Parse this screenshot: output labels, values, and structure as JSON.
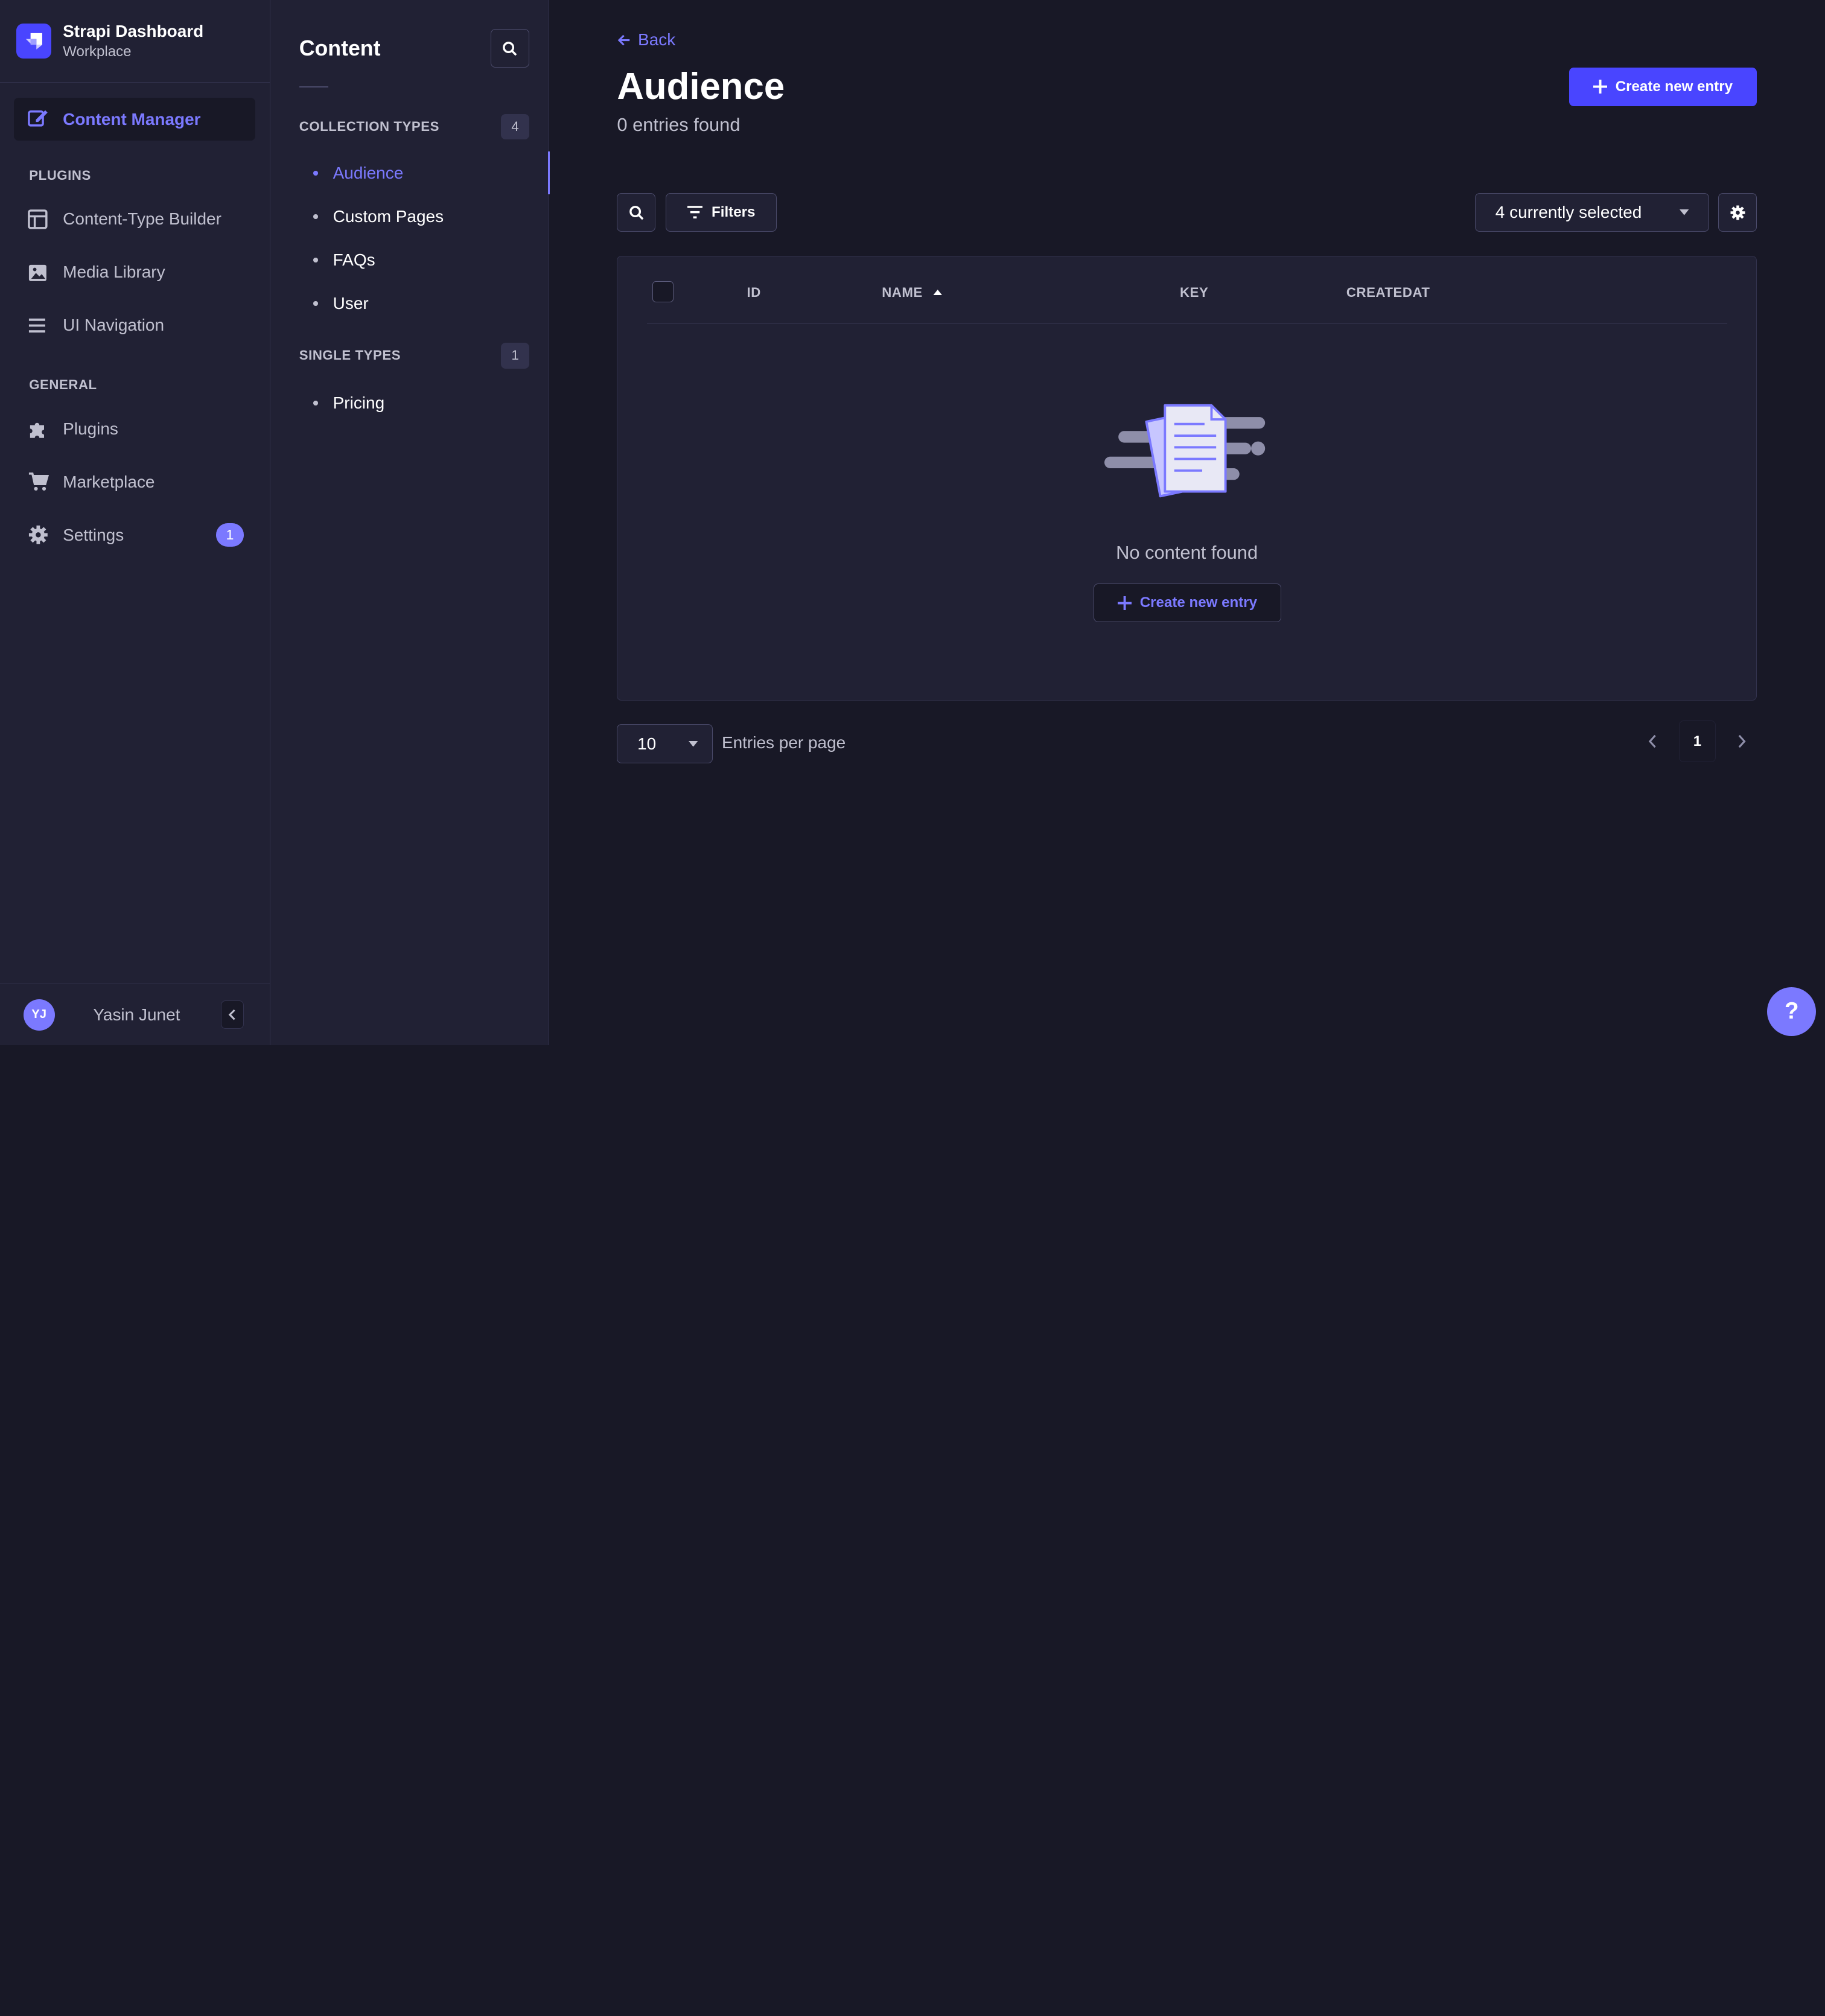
{
  "brand": {
    "title": "Strapi Dashboard",
    "subtitle": "Workplace",
    "logo_icon": "strapi-logo-icon"
  },
  "main_nav": {
    "active": {
      "label": "Content Manager",
      "icon": "content-manager-icon"
    },
    "sections": [
      {
        "label": "PLUGINS",
        "items": [
          {
            "label": "Content-Type Builder",
            "icon": "layout-icon"
          },
          {
            "label": "Media Library",
            "icon": "image-icon"
          },
          {
            "label": "UI Navigation",
            "icon": "list-icon"
          }
        ]
      },
      {
        "label": "GENERAL",
        "items": [
          {
            "label": "Plugins",
            "icon": "puzzle-icon"
          },
          {
            "label": "Marketplace",
            "icon": "cart-icon"
          },
          {
            "label": "Settings",
            "icon": "gear-icon",
            "badge": "1"
          }
        ]
      }
    ]
  },
  "user": {
    "initials": "YJ",
    "name": "Yasin Junet"
  },
  "sub_nav": {
    "title": "Content",
    "collection": {
      "label": "COLLECTION TYPES",
      "count": "4",
      "items": [
        "Audience",
        "Custom Pages",
        "FAQs",
        "User"
      ]
    },
    "single": {
      "label": "SINGLE TYPES",
      "count": "1",
      "items": [
        "Pricing"
      ]
    }
  },
  "header": {
    "back_label": "Back",
    "title": "Audience",
    "subtitle": "0 entries found",
    "create_label": "Create new entry"
  },
  "toolbar": {
    "filters_label": "Filters",
    "columns_select": "4 currently selected"
  },
  "table": {
    "columns": [
      "ID",
      "NAME",
      "KEY",
      "CREATEDAT"
    ],
    "sorted_column": "NAME",
    "empty_text": "No content found",
    "empty_create_label": "Create new entry"
  },
  "pagination": {
    "page_size": "10",
    "page_size_label": "Entries per page",
    "current_page": "1"
  },
  "help_label": "?",
  "colors": {
    "accent": "#7b79ff",
    "primary": "#4945ff",
    "background": "#181826",
    "panel": "#212134"
  }
}
